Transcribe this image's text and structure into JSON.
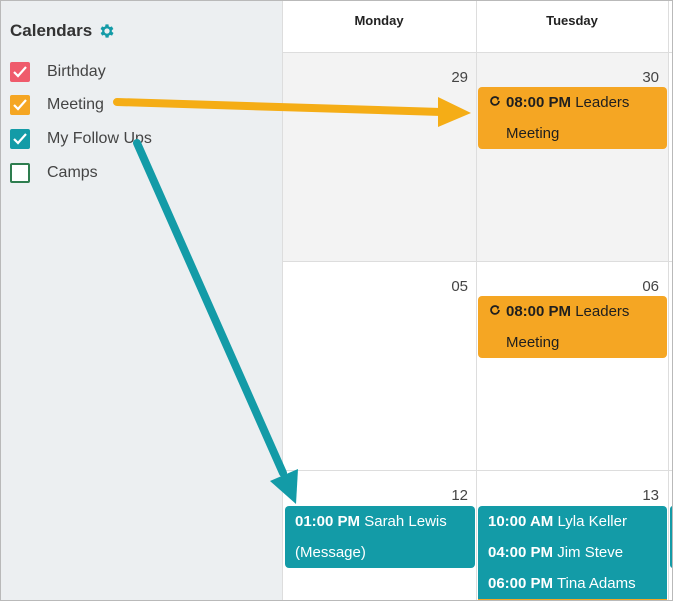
{
  "sidebar": {
    "title": "Calendars",
    "settings_icon": "gear-icon",
    "calendars": [
      {
        "label": "Birthday",
        "checked": true,
        "color": "#ef5b6c"
      },
      {
        "label": "Meeting",
        "checked": true,
        "color": "#f5a623"
      },
      {
        "label": "My Follow Ups",
        "checked": true,
        "color": "#139ba7"
      },
      {
        "label": "Camps",
        "checked": false,
        "color": "#2e7d4f"
      }
    ]
  },
  "calendar": {
    "days": [
      "Monday",
      "Tuesday"
    ],
    "weeks": [
      {
        "monday": "29",
        "tuesday": "30"
      },
      {
        "monday": "05",
        "tuesday": "06"
      },
      {
        "monday": "12",
        "tuesday": "13"
      }
    ],
    "events": {
      "w1_tue": {
        "time": "08:00 PM",
        "title": "Leaders",
        "title2": "Meeting",
        "recurring_icon": "refresh-icon"
      },
      "w2_tue": {
        "time": "08:00 PM",
        "title": "Leaders",
        "title2": "Meeting",
        "recurring_icon": "refresh-icon"
      },
      "w3_mon": {
        "time": "01:00 PM",
        "title": "Sarah Lewis",
        "title2": "(Message)"
      },
      "w3_tue": [
        {
          "time": "10:00 AM",
          "title": "Lyla Keller"
        },
        {
          "time": "04:00 PM",
          "title": "Jim Steve"
        },
        {
          "time": "06:00 PM",
          "title": "Tina Adams"
        }
      ]
    }
  },
  "colors": {
    "meeting": "#f5a623",
    "follow_ups": "#139ba7",
    "birthday": "#ef5b6c",
    "camps": "#2e7d4f",
    "sidebar_bg": "#eceff1"
  }
}
